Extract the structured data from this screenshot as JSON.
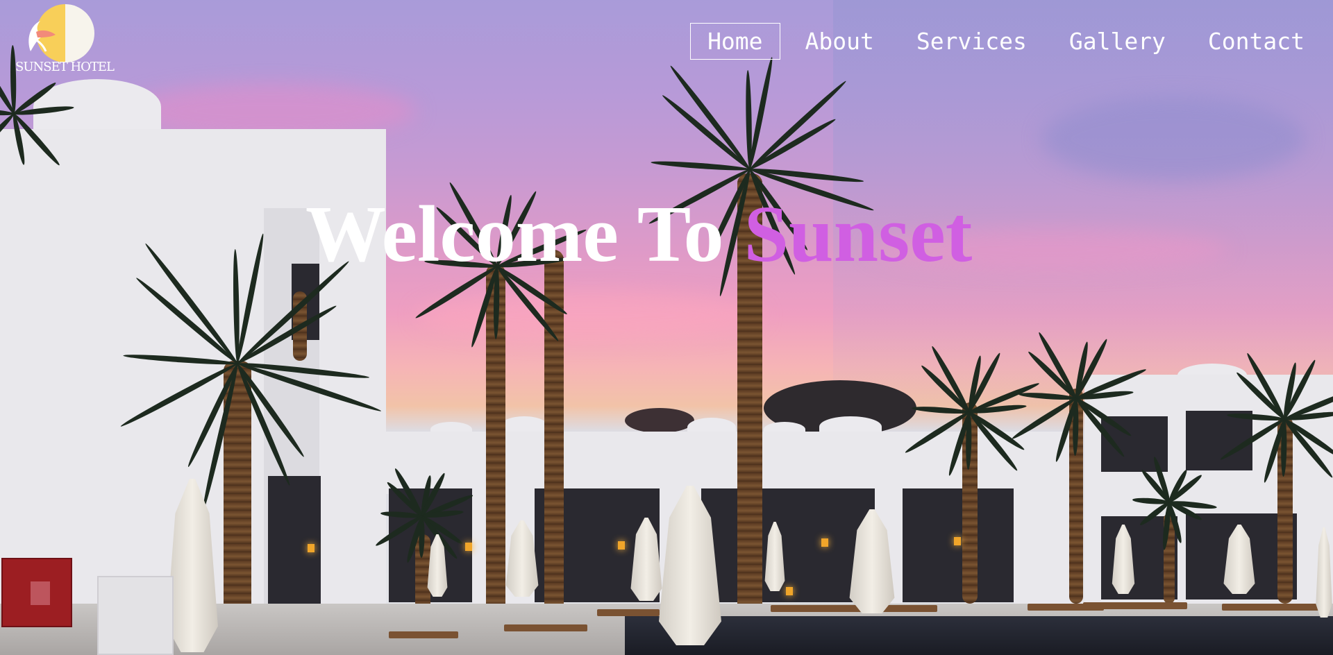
{
  "logo": {
    "text": "SUNSET HOTEL"
  },
  "nav": {
    "items": [
      {
        "label": "Home",
        "active": true
      },
      {
        "label": "About",
        "active": false
      },
      {
        "label": "Services",
        "active": false
      },
      {
        "label": "Gallery",
        "active": false
      },
      {
        "label": "Contact",
        "active": false
      }
    ]
  },
  "hero": {
    "headline_prefix": "Welcome To",
    "headline_accent": "Sunset"
  },
  "colors": {
    "accent": "#d05fe2",
    "nav_text": "#ffffff",
    "logo_sun": "#f8cf59"
  },
  "icons": {
    "logo": "sun-bird-logo-icon"
  }
}
